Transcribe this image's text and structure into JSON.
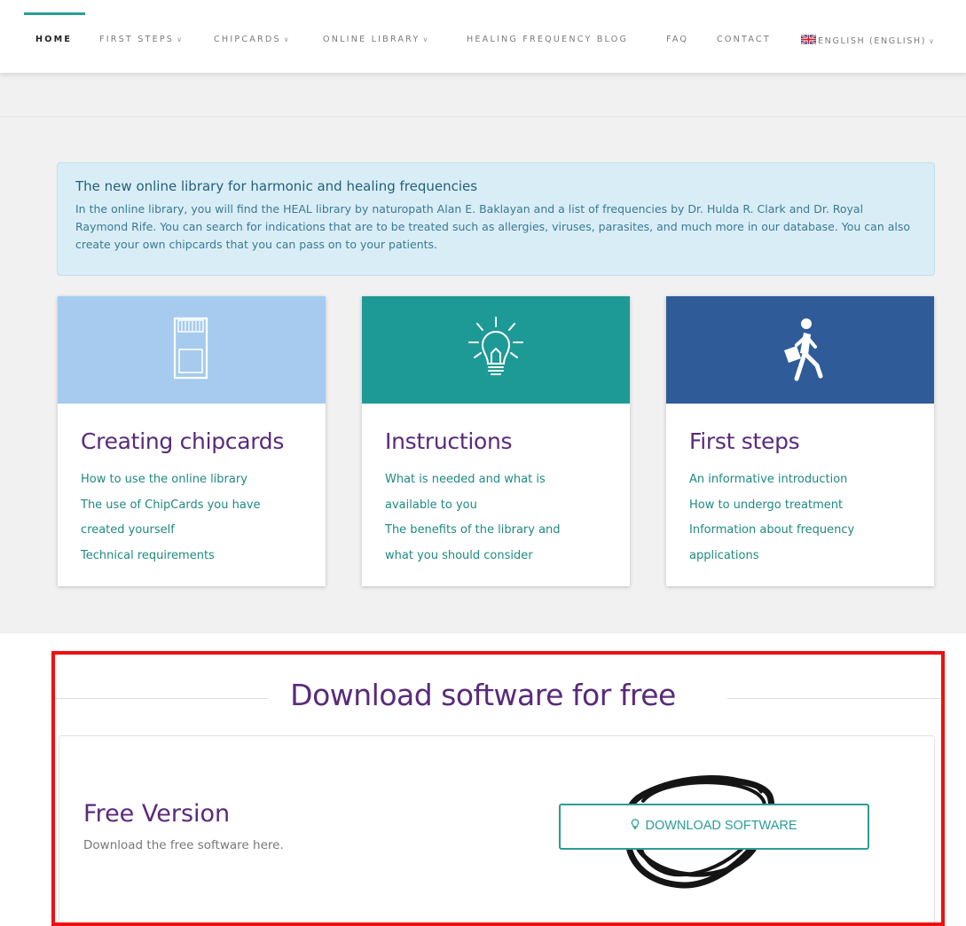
{
  "colors": {
    "accent_teal": "#2a9d95",
    "heading_purple": "#5a2a7a",
    "card1_header": "#a6cbee",
    "card2_header": "#1e9a96",
    "card3_header": "#2f5b98",
    "info_bg": "#d9edf7",
    "highlight_frame": "#ee1010"
  },
  "nav": {
    "items": [
      {
        "label": "HOME",
        "has_caret": false
      },
      {
        "label": "FIRST STEPS",
        "has_caret": true
      },
      {
        "label": "CHIPCARDS",
        "has_caret": true
      },
      {
        "label": "ONLINE LIBRARY",
        "has_caret": true
      },
      {
        "label": "HEALING FREQUENCY BLOG",
        "has_caret": false
      },
      {
        "label": "FAQ",
        "has_caret": false
      },
      {
        "label": "CONTACT",
        "has_caret": false
      }
    ],
    "language": "ENGLISH (ENGLISH)",
    "caret": "∨"
  },
  "info": {
    "title": "The new online library for harmonic and healing frequencies",
    "text": "In the online library, you will find the HEAL library by naturopath Alan E. Baklayan and a list of frequencies by Dr. Hulda R. Clark and Dr. Royal Raymond Rife. You can search for indications that are to be treated such as allergies, viruses, parasites, and much more in our database. You can also create your own chipcards that you can pass on to your patients."
  },
  "cards": [
    {
      "icon": "sd-card-icon",
      "title": "Creating chipcards",
      "links": [
        "How to use the online library",
        "The use of ChipCards you have",
        "created yourself",
        "Technical requirements"
      ]
    },
    {
      "icon": "lightbulb-icon",
      "title": "Instructions",
      "links": [
        "What is needed and what is",
        "available to you",
        "The benefits of the library and",
        "what you should consider"
      ]
    },
    {
      "icon": "walking-person-icon",
      "title": "First steps",
      "links": [
        "An informative introduction",
        "How to undergo treatment",
        "Information about frequency",
        "applications"
      ]
    }
  ],
  "download": {
    "heading": "Download software for free",
    "version_title": "Free Version",
    "version_sub": "Download the free software here.",
    "button_label": "DOWNLOAD SOFTWARE",
    "button_icon": "lightbulb-icon"
  }
}
